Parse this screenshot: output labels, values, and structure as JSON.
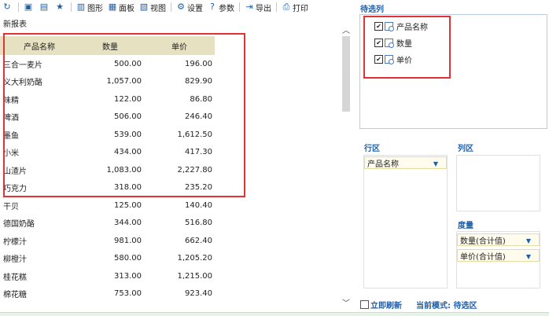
{
  "toolbar": {
    "items": [
      {
        "icon": "refresh-icon",
        "glyph": "↻",
        "label": ""
      },
      {
        "icon": "save-icon",
        "glyph": "▣",
        "label": ""
      },
      {
        "icon": "saveas-icon",
        "glyph": "▤",
        "label": ""
      },
      {
        "icon": "star-icon",
        "glyph": "★",
        "label": ""
      },
      {
        "icon": "chart-icon",
        "glyph": "▥",
        "label": "图形"
      },
      {
        "icon": "panel-icon",
        "glyph": "▦",
        "label": "面板"
      },
      {
        "icon": "view-icon",
        "glyph": "▧",
        "label": "视图"
      },
      {
        "icon": "settings-icon",
        "glyph": "⚙",
        "label": "设置"
      },
      {
        "icon": "params-icon",
        "glyph": "?",
        "label": "参数"
      },
      {
        "icon": "export-icon",
        "glyph": "⇥",
        "label": "导出"
      },
      {
        "icon": "print-icon",
        "glyph": "⎙",
        "label": "打印"
      }
    ]
  },
  "report": {
    "title": "新报表",
    "columns": [
      "产品名称",
      "数量",
      "单价"
    ],
    "rows": [
      [
        "三合一麦片",
        "500.00",
        "196.00"
      ],
      [
        "义大利奶酪",
        "1,057.00",
        "829.90"
      ],
      [
        "味精",
        "122.00",
        "86.80"
      ],
      [
        "啤酒",
        "506.00",
        "246.40"
      ],
      [
        "墨鱼",
        "539.00",
        "1,612.50"
      ],
      [
        "小米",
        "434.00",
        "417.30"
      ],
      [
        "山渣片",
        "1,083.00",
        "2,227.80"
      ],
      [
        "巧克力",
        "318.00",
        "235.20"
      ],
      [
        "干贝",
        "125.00",
        "140.40"
      ],
      [
        "德国奶酪",
        "344.00",
        "516.80"
      ],
      [
        "柠檬汁",
        "981.00",
        "662.40"
      ],
      [
        "柳橙汁",
        "580.00",
        "1,205.20"
      ],
      [
        "桂花糕",
        "313.00",
        "1,215.00"
      ],
      [
        "棉花糖",
        "753.00",
        "923.40"
      ]
    ]
  },
  "candidates": {
    "title": "待选列",
    "fields": [
      "产品名称",
      "数量",
      "单价"
    ]
  },
  "zones": {
    "row_label": "行区",
    "col_label": "列区",
    "measure_label": "度量",
    "row_items": [
      "产品名称"
    ],
    "measure_items": [
      "数量(合计值)",
      "单价(合计值)"
    ]
  },
  "bottom": {
    "auto_refresh": "立即刷新",
    "mode": "当前模式: 待选区"
  },
  "colors": {
    "accent": "#1f5fa8",
    "header_bg": "#e6e1c0",
    "highlight_border": "#e23232"
  }
}
